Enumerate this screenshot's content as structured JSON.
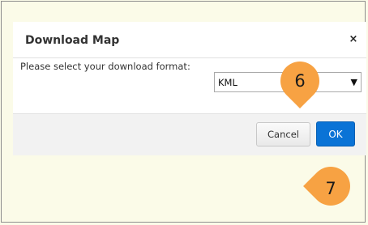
{
  "dialog": {
    "title": "Download Map",
    "close_glyph": "×",
    "format_label": "Please select your download format:",
    "format_value": "KML",
    "dropdown_arrow": "▼",
    "cancel_label": "Cancel",
    "ok_label": "OK"
  },
  "callouts": [
    {
      "number": "6"
    },
    {
      "number": "7"
    }
  ],
  "colors": {
    "callout": "#f7a243",
    "ok_button": "#0a73d6",
    "background": "#fbfbe8"
  }
}
